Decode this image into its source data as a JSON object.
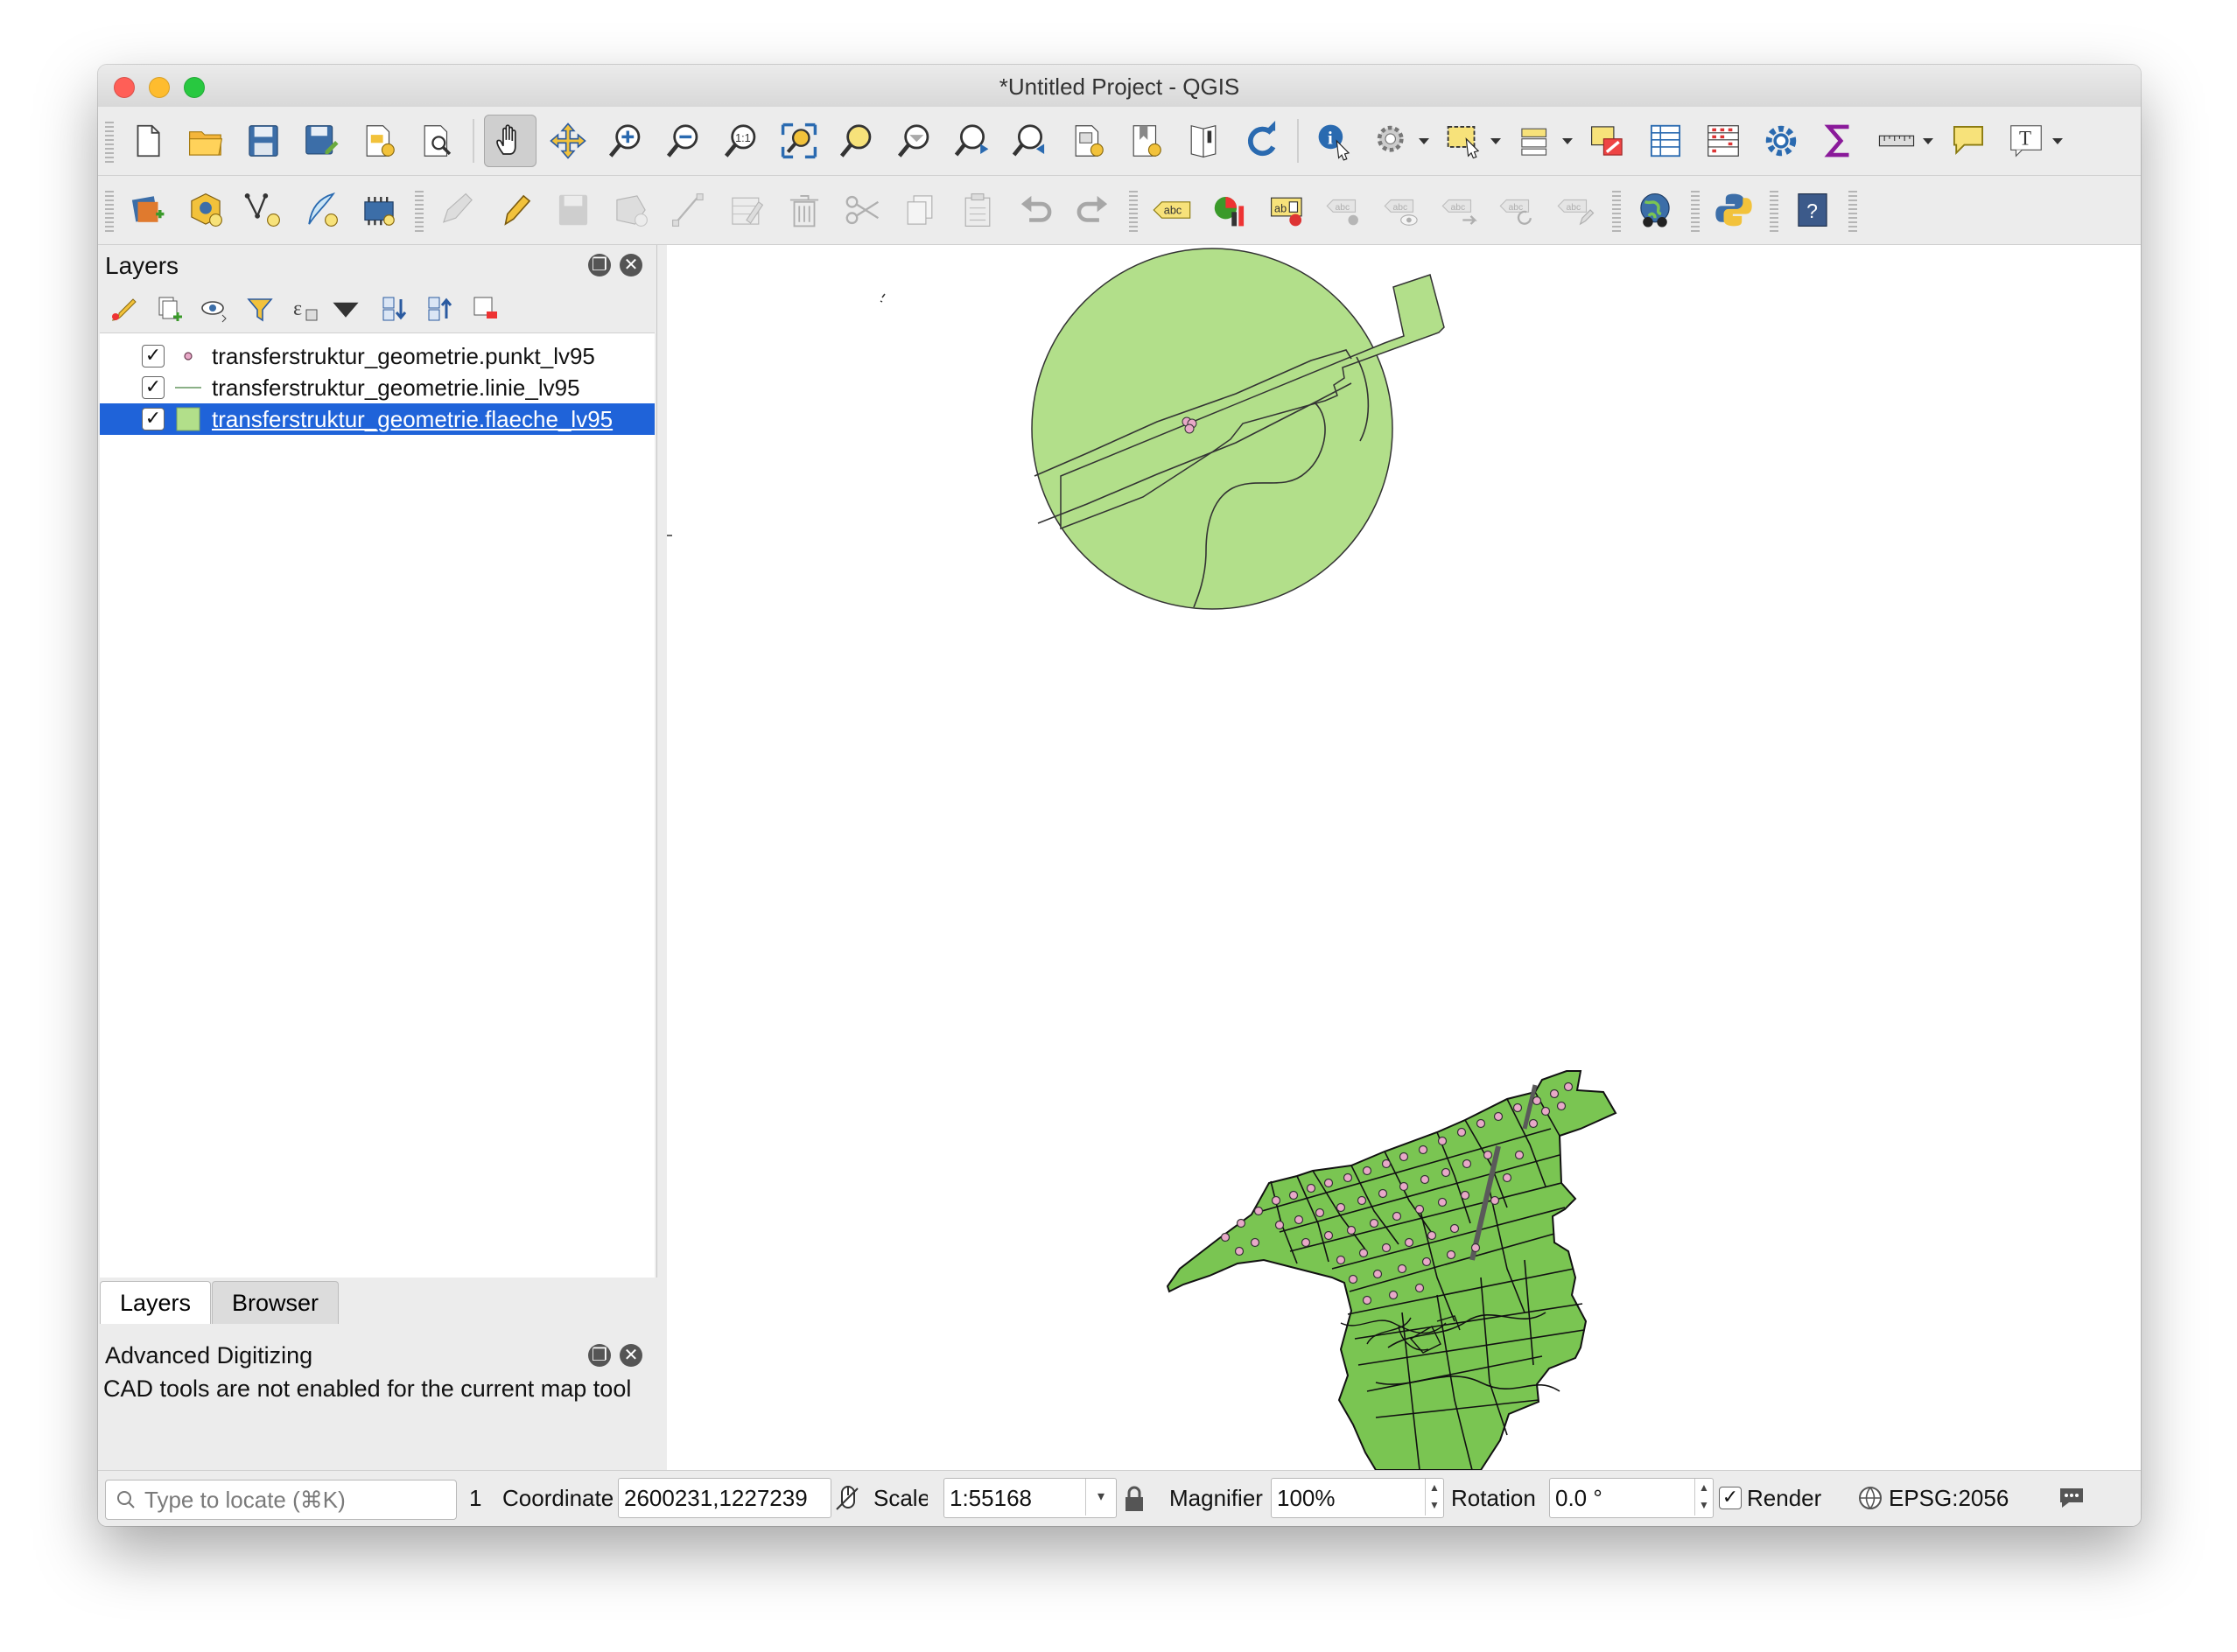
{
  "window": {
    "title": "*Untitled Project - QGIS"
  },
  "colors": {
    "close": "#ff5f57",
    "minimize": "#febc2e",
    "zoom": "#28c840",
    "selection": "#1f63d9",
    "polygon_fill": "#b2df8a",
    "polygon_fill_dark": "#7ac552",
    "point_fill": "#e8a9c8"
  },
  "toolbar1": {
    "icons": [
      "new-project",
      "open-project",
      "save-project",
      "save-as",
      "new-print-layout",
      "layout-manager",
      "pan",
      "pan-to-selection",
      "zoom-in",
      "zoom-out",
      "zoom-native",
      "zoom-full",
      "zoom-selection",
      "zoom-layer",
      "zoom-last",
      "zoom-next",
      "new-bookmark",
      "show-bookmarks",
      "map-tips",
      "refresh",
      "identify",
      "run-action",
      "select-features",
      "select-by-expression",
      "deselect",
      "open-attribute-table",
      "statistical-summary",
      "toolbox",
      "sum",
      "measure",
      "annotation",
      "text-annotation"
    ]
  },
  "toolbar2": {
    "icons": [
      "data-source-manager",
      "new-geopackage",
      "new-shapefile",
      "digitize",
      "new-virtual-layer",
      "current-edits",
      "toggle-editing",
      "save-edits",
      "add-feature",
      "vertex-tool",
      "modify-attributes",
      "delete-selected",
      "cut-features",
      "copy-features",
      "paste-features",
      "undo",
      "redo",
      "label",
      "diagram",
      "layer-labeling",
      "pin-labels",
      "show-hide-labels",
      "move-label",
      "rotate-label",
      "change-label",
      "globe",
      "python",
      "help"
    ]
  },
  "layers_panel": {
    "title": "Layers",
    "layers": [
      {
        "name": "transferstruktur_geometrie.punkt_lv95",
        "checked": "✓",
        "symbol": "point",
        "selected": false
      },
      {
        "name": "transferstruktur_geometrie.linie_lv95",
        "checked": "✓",
        "symbol": "line",
        "selected": false
      },
      {
        "name": "transferstruktur_geometrie.flaeche_lv95",
        "checked": "✓",
        "symbol": "polygon",
        "selected": true
      }
    ]
  },
  "tabs": {
    "layers": "Layers",
    "browser": "Browser"
  },
  "advanced_digitizing": {
    "title": "Advanced Digitizing",
    "message": "CAD tools are not enabled for the current map tool"
  },
  "statusbar": {
    "search_placeholder": "Type to locate (⌘K)",
    "messages_count": "1",
    "coordinate_label": "Coordinate",
    "coordinate_value": "2600231,1227239",
    "scale_label": "Scale",
    "scale_value": "1:55168",
    "magnifier_label": "Magnifier",
    "magnifier_value": "100%",
    "rotation_label": "Rotation",
    "rotation_value": "0.0 °",
    "render_checked": "✓",
    "render_label": "Render",
    "crs": "EPSG:2056"
  }
}
